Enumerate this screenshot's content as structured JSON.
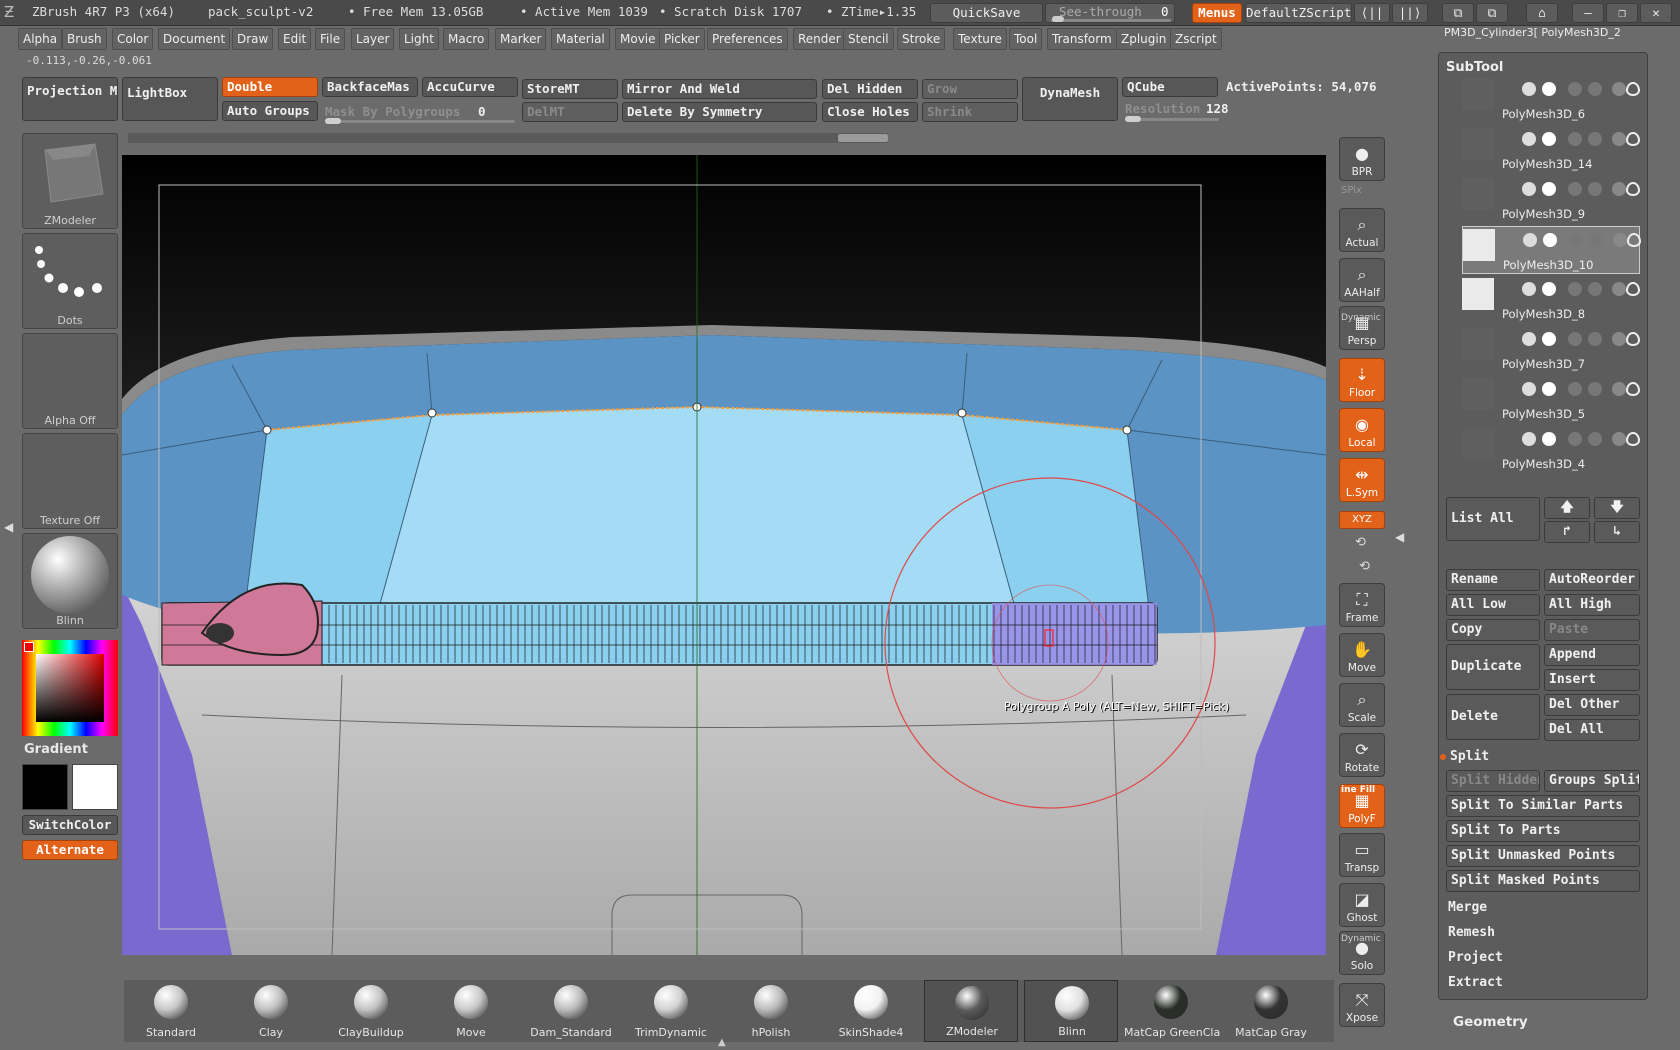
{
  "titlebar": {
    "app": "ZBrush 4R7 P3 (x64)",
    "project": "pack_sculpt-v2",
    "free_mem": "• Free Mem 13.05GB",
    "active_mem": "• Active Mem 1039",
    "scratch": "• Scratch Disk 1707",
    "ztime": "• ZTime▸1.35",
    "quicksave": "QuickSave",
    "see_through_label": "See-through",
    "see_through_value": "0",
    "menus": "Menus",
    "zscript": "DefaultZScript"
  },
  "menubar": [
    "Alpha",
    "Brush",
    "Color",
    "Document",
    "Draw",
    "Edit",
    "File",
    "Layer",
    "Light",
    "Macro",
    "Marker",
    "Material",
    "Movie",
    "Picker",
    "Preferences",
    "Render",
    "Stencil",
    "Stroke",
    "Texture",
    "Tool",
    "Transform",
    "Zplugin",
    "Zscript"
  ],
  "coords": "-0.113,-0.26,-0.061",
  "topshelf": {
    "projection_master": "Projection Master",
    "lightbox": "LightBox",
    "double": "Double",
    "backface": "BackfaceMas",
    "accucurve": "AccuCurve",
    "auto_groups": "Auto Groups",
    "mask_by_polygroups": "Mask By Polygroups",
    "mask_value": "0",
    "storemt": "StoreMT",
    "delmt": "DelMT",
    "mirror_weld": "Mirror And Weld",
    "delete_by_symmetry": "Delete By Symmetry",
    "del_hidden": "Del Hidden",
    "close_holes": "Close Holes",
    "grow": "Grow",
    "shrink": "Shrink",
    "dynamesh": "DynaMesh",
    "qcube": "QCube",
    "resolution_label": "Resolution",
    "resolution_value": "128",
    "active_points": "ActivePoints: 54,076"
  },
  "leftpanel": {
    "brush": "ZModeler",
    "stroke": "Dots",
    "alpha": "Alpha  Off",
    "texture": "Texture  Off",
    "material": "Blinn",
    "gradient": "Gradient",
    "switchcolor": "SwitchColor",
    "alternate": "Alternate"
  },
  "canvas": {
    "tooltip": "Polygroup A Poly (ALT=New, SHIFT=Pick)"
  },
  "righttools": [
    {
      "icon": "bpr-icon",
      "label": "BPR",
      "orange": false
    },
    {
      "icon": "actual-icon",
      "label": "Actual",
      "orange": false
    },
    {
      "icon": "aahalf-icon",
      "label": "AAHalf",
      "orange": false
    },
    {
      "icon": "persp-icon",
      "label": "Persp",
      "orange": false
    },
    {
      "icon": "floor-icon",
      "label": "Floor",
      "orange": true
    },
    {
      "icon": "local-icon",
      "label": "Local",
      "orange": true
    },
    {
      "icon": "lsym-icon",
      "label": "L.Sym",
      "orange": true
    },
    {
      "icon": "frame-icon",
      "label": "Frame",
      "orange": false
    },
    {
      "icon": "move-icon",
      "label": "Move",
      "orange": false
    },
    {
      "icon": "scale-icon",
      "label": "Scale",
      "orange": false
    },
    {
      "icon": "rotate-icon",
      "label": "Rotate",
      "orange": false
    },
    {
      "icon": "polyf-icon",
      "label": "PolyF",
      "orange": true
    },
    {
      "icon": "transp-icon",
      "label": "Transp",
      "orange": false
    },
    {
      "icon": "ghost-icon",
      "label": "Ghost",
      "orange": false
    },
    {
      "icon": "solo-icon",
      "label": "Solo",
      "orange": false
    },
    {
      "icon": "xpose-icon",
      "label": "Xpose",
      "orange": false
    }
  ],
  "righttool_extras": {
    "spix": "SPix",
    "dynamic": "Dynamic",
    "xyz": "XYZ",
    "line_fill": "ine Fill",
    "dynamic2": "Dynamic"
  },
  "bottomshelf": [
    {
      "label": "Standard",
      "color": "#c8c8c8"
    },
    {
      "label": "Clay",
      "color": "#c0c0c0"
    },
    {
      "label": "ClayBuildup",
      "color": "#c4c4c4"
    },
    {
      "label": "Move",
      "color": "#cacaca"
    },
    {
      "label": "Dam_Standard",
      "color": "#bdbdbd"
    },
    {
      "label": "TrimDynamic",
      "color": "#d2d2d2"
    },
    {
      "label": "hPolish",
      "color": "#bcbcbc"
    },
    {
      "label": "SkinShade4",
      "color": "#f2f2f2"
    },
    {
      "label": "ZModeler",
      "color": "#5a5a5a"
    },
    {
      "label": "Blinn",
      "color": "#e0e0e0"
    },
    {
      "label": "MatCap GreenCla",
      "color": "#2a2f2a"
    },
    {
      "label": "MatCap Gray",
      "color": "#333333"
    }
  ],
  "subtool": {
    "header": "SubTool",
    "top_names": "PM3D_Cylinder3[  PolyMesh3D_2",
    "items": [
      {
        "name": "PolyMesh3D_6",
        "selected": false
      },
      {
        "name": "PolyMesh3D_14",
        "selected": false
      },
      {
        "name": "PolyMesh3D_9",
        "selected": false
      },
      {
        "name": "PolyMesh3D_10",
        "selected": true
      },
      {
        "name": "PolyMesh3D_8",
        "selected": false
      },
      {
        "name": "PolyMesh3D_7",
        "selected": false
      },
      {
        "name": "PolyMesh3D_5",
        "selected": false
      },
      {
        "name": "PolyMesh3D_4",
        "selected": false
      }
    ],
    "list_all": "List All",
    "rename": "Rename",
    "autoreorder": "AutoReorder",
    "all_low": "All Low",
    "all_high": "All High",
    "copy": "Copy",
    "paste": "Paste",
    "duplicate": "Duplicate",
    "append": "Append",
    "insert": "Insert",
    "delete": "Delete",
    "del_other": "Del Other",
    "del_all": "Del All",
    "split": "Split",
    "split_hidden": "Split Hidden",
    "groups_split": "Groups Split",
    "split_similar": "Split To Similar Parts",
    "split_parts": "Split To Parts",
    "split_unmasked": "Split Unmasked Points",
    "split_masked": "Split Masked Points",
    "merge": "Merge",
    "remesh": "Remesh",
    "project": "Project",
    "extract": "Extract",
    "geometry": "Geometry"
  },
  "colors": {
    "accent": "#e3621a",
    "mesh_light": "#8cd0f0",
    "mesh_mid": "#5a93c4",
    "mesh_purple": "#7a6ad0",
    "pink": "#d07898",
    "brush_ring": "#e04848"
  }
}
